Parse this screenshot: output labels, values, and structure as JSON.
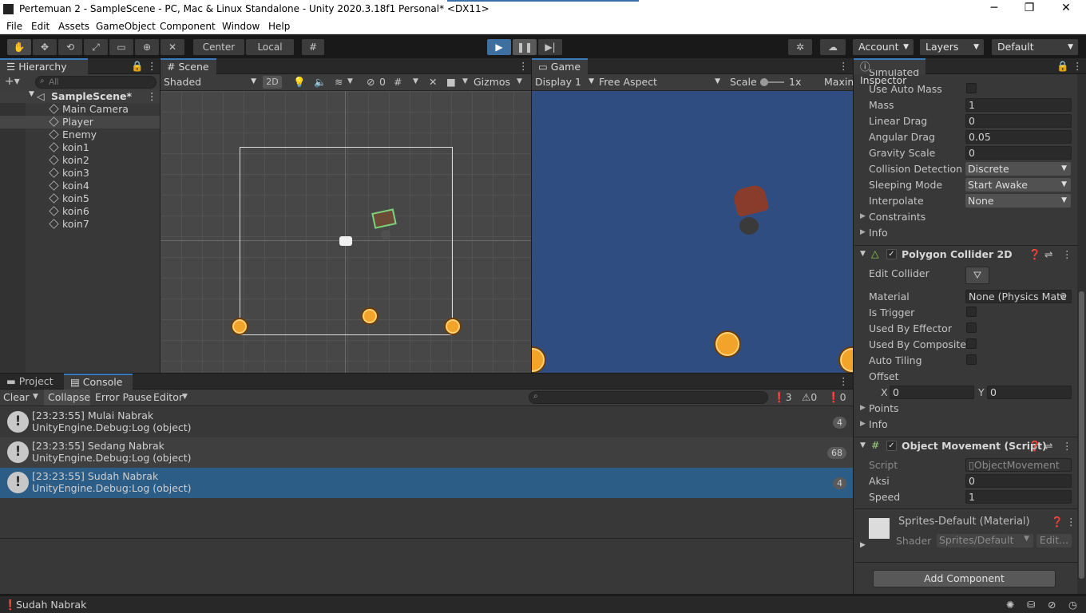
{
  "window": {
    "title": "Pertemuan 2 - SampleScene - PC, Mac & Linux Standalone - Unity 2020.3.18f1 Personal* <DX11>"
  },
  "menu": [
    "File",
    "Edit",
    "Assets",
    "GameObject",
    "Component",
    "Window",
    "Help"
  ],
  "toolbar": {
    "center": "Center",
    "local": "Local",
    "account": "Account",
    "layers": "Layers",
    "layout": "Default"
  },
  "hierarchy": {
    "tab": "Hierarchy",
    "search_placeholder": "All",
    "scene": "SampleScene*",
    "items": [
      "Main Camera",
      "Player",
      "Enemy",
      "koin1",
      "koin2",
      "koin3",
      "koin4",
      "koin5",
      "koin6",
      "koin7"
    ]
  },
  "scene": {
    "tab": "Scene",
    "shading": "Shaded",
    "mode_2d": "2D",
    "hidden_count": "0",
    "gizmos": "Gizmos"
  },
  "game": {
    "tab": "Game",
    "display": "Display 1",
    "aspect": "Free Aspect",
    "scale_label": "Scale",
    "scale_value": "1x",
    "maximize": "Maximi"
  },
  "bottom": {
    "tabs": [
      "Project",
      "Console"
    ],
    "clear": "Clear",
    "collapse": "Collapse",
    "error_pause": "Error Pause",
    "editor": "Editor",
    "counts": {
      "log": "3",
      "warn": "0",
      "error": "0"
    },
    "logs": [
      {
        "line1": "[23:23:55] Mulai Nabrak",
        "line2": "UnityEngine.Debug:Log (object)",
        "count": "4"
      },
      {
        "line1": "[23:23:55] Sedang Nabrak",
        "line2": "UnityEngine.Debug:Log (object)",
        "count": "68"
      },
      {
        "line1": "[23:23:55] Sudah Nabrak",
        "line2": "UnityEngine.Debug:Log (object)",
        "count": "4"
      }
    ]
  },
  "status": {
    "message": "Sudah Nabrak"
  },
  "inspector": {
    "tab": "Inspector",
    "cut_label": "Simulated",
    "rigidbody": [
      {
        "label": "Use Auto Mass",
        "type": "check"
      },
      {
        "label": "Mass",
        "value": "1"
      },
      {
        "label": "Linear Drag",
        "value": "0"
      },
      {
        "label": "Angular Drag",
        "value": "0.05"
      },
      {
        "label": "Gravity Scale",
        "value": "0"
      },
      {
        "label": "Collision Detection",
        "value": "Discrete"
      },
      {
        "label": "Sleeping Mode",
        "value": "Start Awake"
      },
      {
        "label": "Interpolate",
        "value": "None"
      }
    ],
    "constraints": "Constraints",
    "info": "Info",
    "polygon": {
      "title": "Polygon Collider 2D",
      "edit_collider": "Edit Collider",
      "material_label": "Material",
      "material_value": "None (Physics Mate",
      "is_trigger": "Is Trigger",
      "used_by_effector": "Used By Effector",
      "used_by_composite": "Used By Composite",
      "auto_tiling": "Auto Tiling",
      "offset": "Offset",
      "x_label": "X",
      "x": "0",
      "y_label": "Y",
      "y": "0",
      "points": "Points",
      "info": "Info"
    },
    "script": {
      "title": "Object Movement (Script)",
      "script_label": "Script",
      "script_value": "ObjectMovement",
      "aksi_label": "Aksi",
      "aksi": "0",
      "speed_label": "Speed",
      "speed": "1"
    },
    "material": {
      "name": "Sprites-Default (Material)",
      "shader_label": "Shader",
      "shader": "Sprites/Default",
      "edit": "Edit..."
    },
    "add_component": "Add Component"
  }
}
